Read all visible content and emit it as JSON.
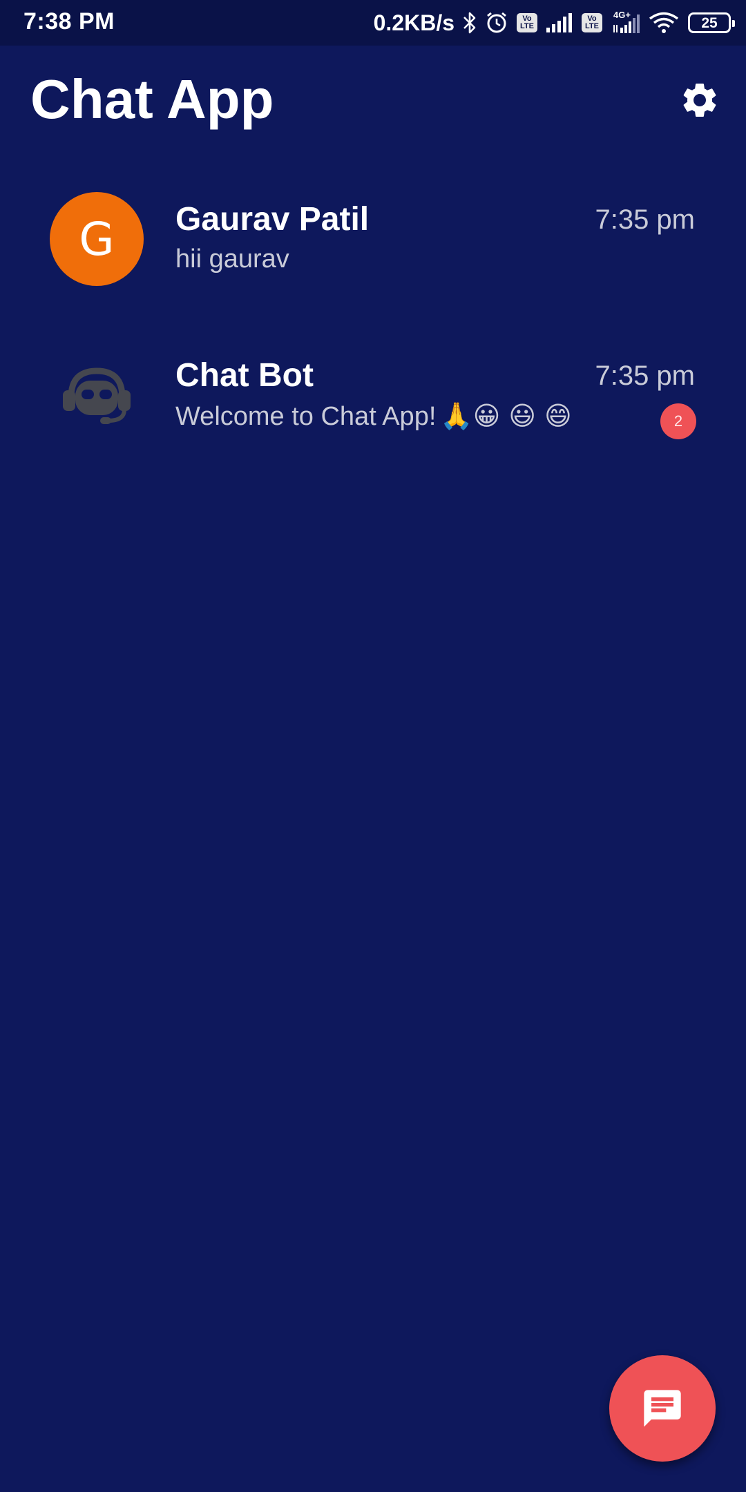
{
  "status_bar": {
    "time": "7:38 PM",
    "net_speed": "0.2KB/s",
    "volte_1": "Vo LTE",
    "volte_2": "Vo LTE",
    "network_type": "4G+",
    "battery": "25",
    "icons": [
      "bluetooth-icon",
      "alarm-icon",
      "signal-icon",
      "wifi-icon",
      "battery-icon"
    ]
  },
  "header": {
    "title": "Chat App",
    "settings_icon": "gear-icon"
  },
  "chats": [
    {
      "name": "Gaurav Patil",
      "avatar_letter": "G",
      "avatar_color": "#f06e0a",
      "time": "7:35 pm",
      "preview": "hii gaurav",
      "unread": null
    },
    {
      "name": "Chat Bot",
      "avatar_icon": "robot-headset-icon",
      "time": "7:35 pm",
      "preview": "Welcome to Chat App!",
      "preview_emojis": "🙏😀 😃 😄",
      "unread": "2"
    }
  ],
  "fab": {
    "icon": "chat-message-icon",
    "color": "#ef5256"
  },
  "colors": {
    "background": "#0e185c",
    "status_bar": "#0a1248",
    "accent": "#ef5256",
    "secondary_text": "#c9cbd8"
  }
}
